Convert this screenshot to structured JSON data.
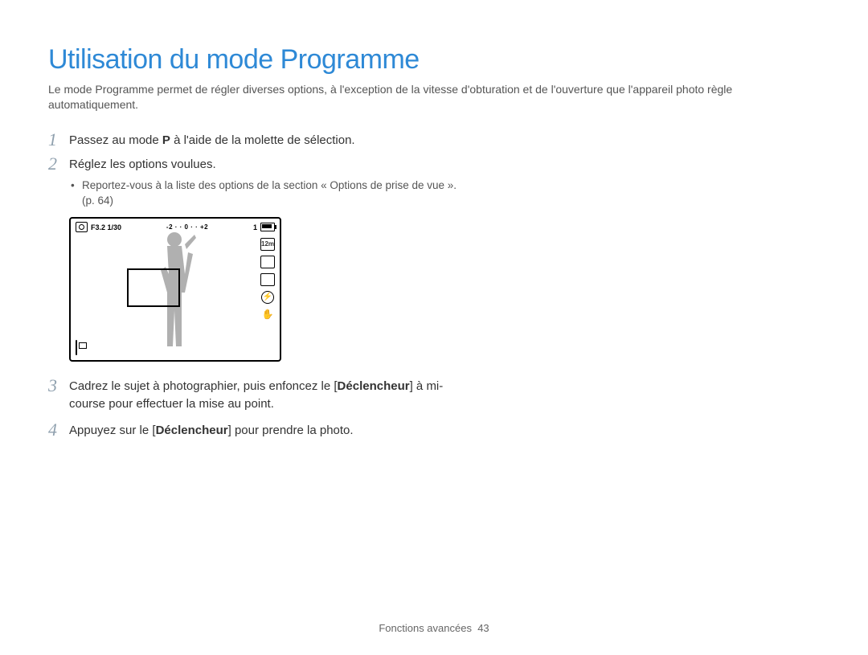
{
  "title": "Utilisation du mode Programme",
  "intro": "Le mode Programme permet de régler diverses options, à l'exception de la vitesse d'obturation et de l'ouverture que l'appareil photo règle automatiquement.",
  "steps": {
    "s1": {
      "num": "1",
      "pre": "Passez au mode ",
      "bold": "P",
      "post": " à l'aide de la molette de sélection."
    },
    "s2": {
      "num": "2",
      "text": "Réglez les options voulues.",
      "bullet": "Reportez-vous à la liste des options de la section « Options de prise de vue ». (p. 64)"
    },
    "s3": {
      "num": "3",
      "part1": "Cadrez le sujet à photographier, puis enfoncez le [",
      "bold": "Déclencheur",
      "part2": "] à mi-course pour effectuer la mise au point."
    },
    "s4": {
      "num": "4",
      "part1": "Appuyez sur le [",
      "bold": "Déclencheur",
      "part2": "] pour prendre la photo."
    }
  },
  "lcd": {
    "aperture_shutter": "F3.2 1/30",
    "ev_scale": "-2 · · 0 · · +2",
    "shots_remaining": "1",
    "right_icons": [
      "resolution-12m-icon",
      "metering-icon",
      "iso-auto-icon",
      "flash-off-icon",
      "ois-icon"
    ],
    "left_bottom_icon": "af-area-icon",
    "top_left_icon": "camera-mode-icon",
    "battery_icon": "battery-full-icon"
  },
  "footer": {
    "section": "Fonctions avancées",
    "page": "43"
  }
}
